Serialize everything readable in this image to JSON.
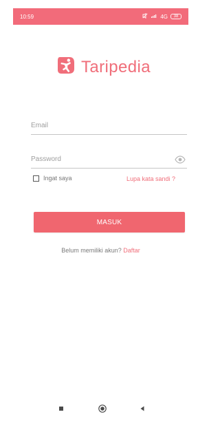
{
  "statusbar": {
    "time": "10:59",
    "network": "4G",
    "battery": "38"
  },
  "brand": {
    "name": "Taripedia"
  },
  "login": {
    "email_placeholder": "Email",
    "password_placeholder": "Password",
    "remember_label": "Ingat saya",
    "forgot_label": "Lupa kata sandi ?",
    "submit_label": "MASUK",
    "signup_prompt": "Belum memiliki akun?",
    "signup_link": "Daftar"
  },
  "colors": {
    "accent": "#f06e7a",
    "statusbar": "#f26b7a",
    "button": "#f0666f"
  },
  "icons": {
    "logo": "taripedia-logo-icon",
    "eye": "eye-icon",
    "nav_square": "recent-apps-icon",
    "nav_home": "home-icon",
    "nav_back": "back-icon"
  }
}
